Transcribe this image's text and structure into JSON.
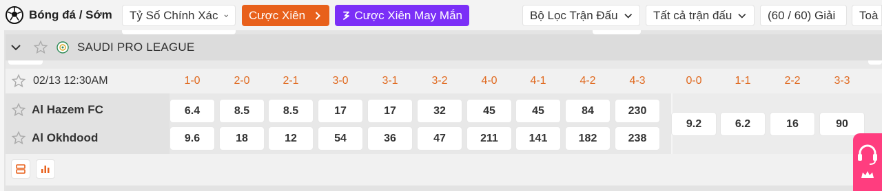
{
  "topbar": {
    "brand": "Bóng đá / Sớm",
    "market_select": "Tỷ Số Chính Xác",
    "parlay_label": "Cược Xiên",
    "lucky_parlay_label": "Cược Xiên May Mắn",
    "match_filter": "Bộ Lọc Trận Đấu",
    "all_matches": "Tất cả trận đấu",
    "league_count": "(60 / 60) Giải",
    "cutoff_text": "Toà"
  },
  "league": {
    "name": "SAUDI PRO LEAGUE"
  },
  "match": {
    "datetime": "02/13 12:30AM",
    "home_team": "Al Hazem FC",
    "away_team": "Al Okhdood",
    "score_headers": [
      "1-0",
      "2-0",
      "2-1",
      "3-0",
      "3-1",
      "3-2",
      "4-0",
      "4-1",
      "4-2",
      "4-3"
    ],
    "draw_headers": [
      "0-0",
      "1-1",
      "2-2",
      "3-3"
    ],
    "home_odds": [
      "6.4",
      "8.5",
      "8.5",
      "17",
      "17",
      "32",
      "45",
      "45",
      "84",
      "230"
    ],
    "away_odds": [
      "9.6",
      "18",
      "12",
      "54",
      "36",
      "47",
      "211",
      "141",
      "182",
      "238"
    ],
    "draw_odds": [
      "9.2",
      "6.2",
      "16",
      "90"
    ]
  },
  "colors": {
    "accent_orange": "#e8601b",
    "accent_purple": "#7b2ff7",
    "score_header": "#e0691f",
    "support_pink": "#ff3d7f"
  },
  "icons": {
    "brand": "soccer-ball-icon",
    "favorite": "star-outline-icon",
    "collapse": "chevron-down-icon",
    "league": "league-emblem-icon",
    "footer": [
      "list-view-icon",
      "stats-chart-icon"
    ],
    "support": "headset-icon"
  }
}
